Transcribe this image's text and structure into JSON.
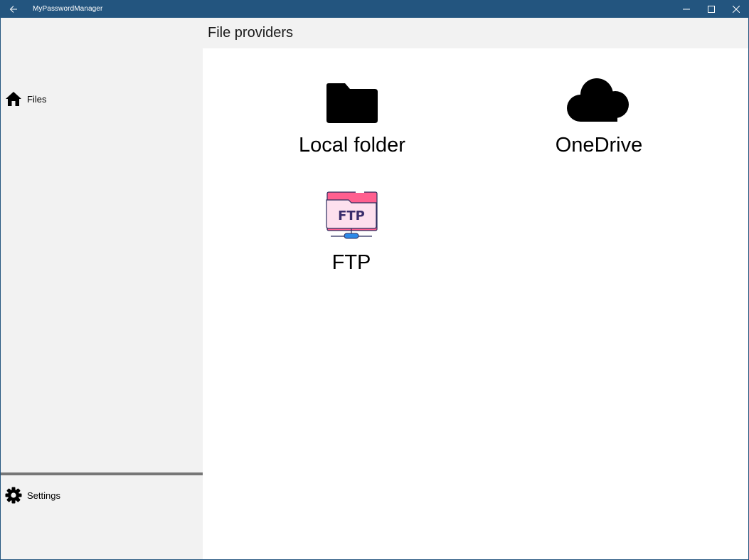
{
  "window": {
    "title": "MyPasswordManager",
    "controls": [
      "minimize",
      "maximize",
      "close"
    ],
    "accent_color": "#23557f"
  },
  "sidebar": {
    "items": [
      {
        "label": "Files",
        "icon": "home-icon"
      }
    ],
    "footer_items": [
      {
        "label": "Settings",
        "icon": "gear-icon"
      }
    ]
  },
  "header": {
    "title": "File providers"
  },
  "providers": [
    {
      "label": "Local folder",
      "icon": "folder-icon"
    },
    {
      "label": "OneDrive",
      "icon": "cloud-icon"
    },
    {
      "label": "FTP",
      "icon": "ftp-folder-icon",
      "icon_text": "FTP"
    }
  ]
}
